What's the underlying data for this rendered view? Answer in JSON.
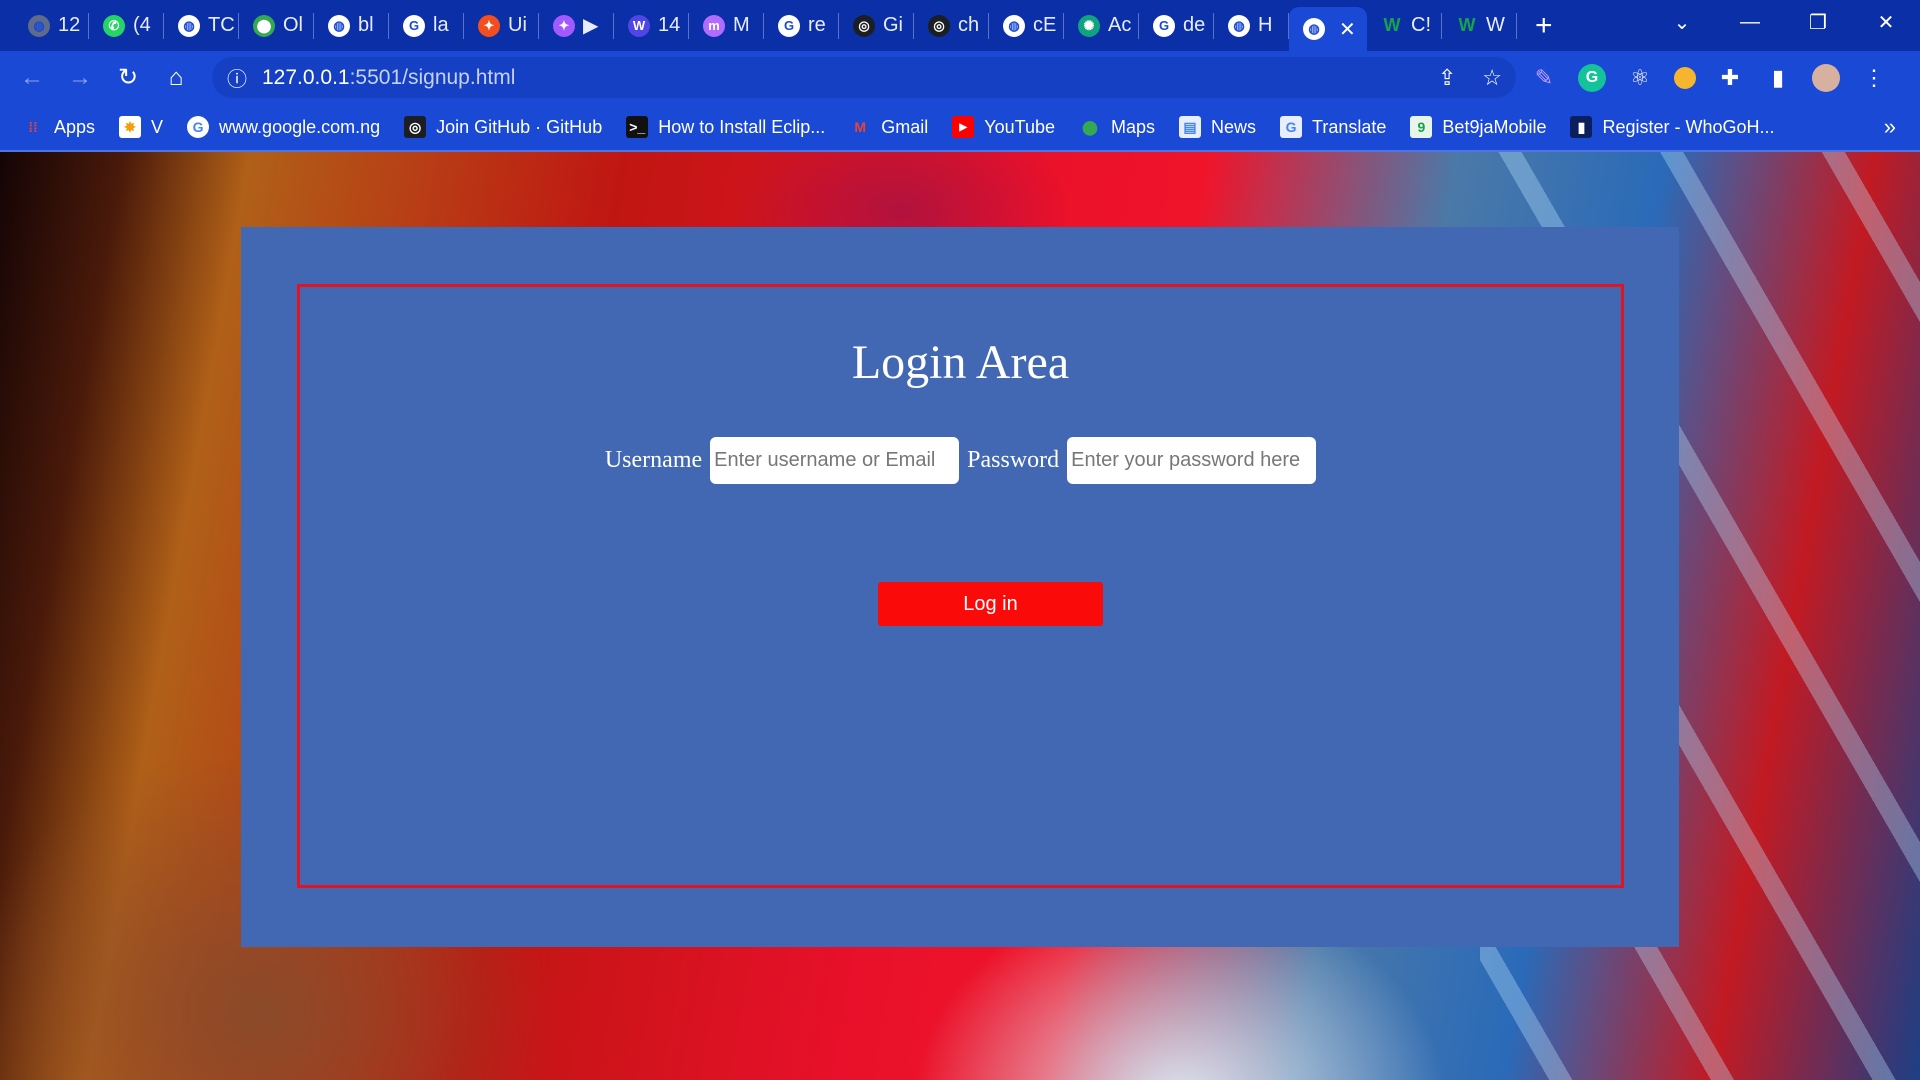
{
  "browser": {
    "tabs": [
      {
        "label": "12",
        "icon": "globe-icon",
        "color": "#5f6b8a"
      },
      {
        "label": "(4",
        "icon": "whatsapp-icon",
        "color": "#25d366"
      },
      {
        "label": "TC",
        "icon": "globe-icon",
        "color": "#ffffff"
      },
      {
        "label": "Ol",
        "icon": "maps-pin-icon",
        "color": "#34a853"
      },
      {
        "label": "bl",
        "icon": "globe-icon",
        "color": "#ffffff"
      },
      {
        "label": "la",
        "icon": "google-icon",
        "color": "#ffffff"
      },
      {
        "label": "Ui",
        "icon": "figma-icon",
        "color": "#f24e1e"
      },
      {
        "label": "▶",
        "icon": "figma-icon",
        "color": "#a259ff"
      },
      {
        "label": "14",
        "icon": "w-icon",
        "color": "#4f46e5"
      },
      {
        "label": "M",
        "icon": "m-icon",
        "color": "#b06cff"
      },
      {
        "label": "re",
        "icon": "google-icon",
        "color": "#ffffff"
      },
      {
        "label": "Gi",
        "icon": "github-icon",
        "color": "#1b1f23"
      },
      {
        "label": "ch",
        "icon": "github-icon",
        "color": "#1b1f23"
      },
      {
        "label": "cE",
        "icon": "globe-icon",
        "color": "#ffffff"
      },
      {
        "label": "Ac",
        "icon": "chatgpt-icon",
        "color": "#10a37f"
      },
      {
        "label": "de",
        "icon": "google-icon",
        "color": "#ffffff"
      },
      {
        "label": "H",
        "icon": "globe-icon",
        "color": "#ffffff"
      }
    ],
    "active_tab": {
      "icon": "globe-icon",
      "close": "✕"
    },
    "trailing_tabs": [
      {
        "label": "C!",
        "icon": "w-green-icon",
        "color": "#16a34a"
      },
      {
        "label": "W",
        "icon": "w-green-icon",
        "color": "#16a34a"
      }
    ],
    "new_tab": "+",
    "url_host": "127.0.0.1",
    "url_rest": ":5501/signup.html",
    "bookmarks": [
      {
        "label": "Apps",
        "icon": "apps-grid-icon",
        "color": "#ea4335"
      },
      {
        "label": "V",
        "icon": "star-burst-icon",
        "color": "#f59e0b"
      },
      {
        "label": "www.google.com.ng",
        "icon": "google-icon",
        "color": "#ffffff"
      },
      {
        "label": "Join GitHub · GitHub",
        "icon": "github-icon",
        "color": "#1b1f23"
      },
      {
        "label": "How to Install Eclip...",
        "icon": "terminal-icon",
        "color": "#111111"
      },
      {
        "label": "Gmail",
        "icon": "gmail-icon",
        "color": "#ea4335"
      },
      {
        "label": "YouTube",
        "icon": "youtube-icon",
        "color": "#ff0000"
      },
      {
        "label": "Maps",
        "icon": "maps-pin-icon",
        "color": "#34a853"
      },
      {
        "label": "News",
        "icon": "news-icon",
        "color": "#4285f4"
      },
      {
        "label": "Translate",
        "icon": "translate-icon",
        "color": "#4285f4"
      },
      {
        "label": "Bet9jaMobile",
        "icon": "bet9ja-icon",
        "color": "#16a34a"
      },
      {
        "label": "Register - WhoGoH...",
        "icon": "bookmark-dark-icon",
        "color": "#0b1f5c"
      }
    ]
  },
  "page": {
    "title": "Login Area",
    "username_label": "Username",
    "username_placeholder": "Enter username or Email",
    "password_label": "Password",
    "password_placeholder": "Enter your password here",
    "login_button": "Log in",
    "colors": {
      "panel": "#4268b4",
      "border": "#e01422",
      "button": "#fb0a0a"
    }
  }
}
